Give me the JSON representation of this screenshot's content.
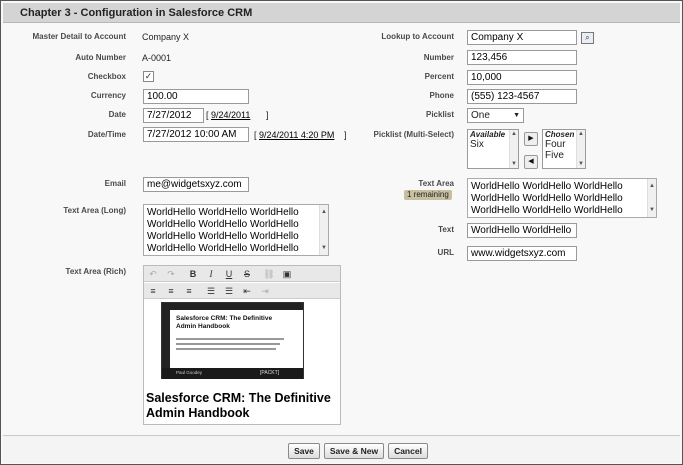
{
  "header": {
    "title": "Chapter 3 - Configuration in Salesforce CRM"
  },
  "left": {
    "master_detail": {
      "label": "Master Detail to Account",
      "value": "Company X"
    },
    "auto_number": {
      "label": "Auto Number",
      "value": "A-0001"
    },
    "checkbox": {
      "label": "Checkbox",
      "checked_mark": "✓"
    },
    "currency": {
      "label": "Currency",
      "value": "100.00"
    },
    "date": {
      "label": "Date",
      "value": "7/27/2012",
      "bracket_open": "[",
      "link": "9/24/2011",
      "bracket_close": "]"
    },
    "datetime": {
      "label": "Date/Time",
      "value": "7/27/2012 10:00 AM",
      "bracket_open": "[",
      "link": "9/24/2011 4:20 PM",
      "bracket_close": "]"
    },
    "email": {
      "label": "Email",
      "value": "me@widgetsxyz.com"
    },
    "text_area_long": {
      "label": "Text Area (Long)",
      "lines": [
        "WorldHello WorldHello WorldHello",
        "WorldHello WorldHello WorldHello",
        "WorldHello WorldHello WorldHello",
        "WorldHello WorldHello WorldHello"
      ]
    },
    "text_area_rich": {
      "label": "Text Area (Rich)",
      "toolbar_row1": [
        "↶",
        "↷",
        "B",
        "I",
        "U",
        "S",
        "⛓",
        "▣"
      ],
      "toolbar_row2": [
        "≡",
        "≡",
        "≡",
        "☰",
        "☰",
        "⇤",
        "⇥"
      ],
      "book": {
        "title_line1": "Salesforce CRM: The Definitive",
        "title_line2": "Admin Handbook",
        "author": "Paul Goodey",
        "publisher": "[PACKT]"
      },
      "heading_line1": "Salesforce CRM: The Definitive",
      "heading_line2": "Admin Handbook"
    }
  },
  "right": {
    "lookup": {
      "label": "Lookup to Account",
      "value": "Company X"
    },
    "number": {
      "label": "Number",
      "value": "123,456"
    },
    "percent": {
      "label": "Percent",
      "value": "10,000"
    },
    "phone": {
      "label": "Phone",
      "value": "(555) 123-4567"
    },
    "picklist": {
      "label": "Picklist",
      "value": "One"
    },
    "multiselect": {
      "label": "Picklist (Multi-Select)",
      "available_header": "Available",
      "available": [
        "Six"
      ],
      "chosen_header": "Chosen",
      "chosen": [
        "Four",
        "Five"
      ],
      "add_arrow": "▶",
      "remove_arrow": "◀"
    },
    "text_area": {
      "label": "Text Area",
      "remaining": "1 remaining",
      "lines": [
        "WorldHello WorldHello WorldHello",
        "WorldHello WorldHello WorldHello",
        "WorldHello WorldHello WorldHello"
      ]
    },
    "text": {
      "label": "Text",
      "value": "WorldHello WorldHello"
    },
    "url": {
      "label": "URL",
      "value": "www.widgetsxyz.com"
    }
  },
  "footer": {
    "save": "Save",
    "save_new": "Save & New",
    "cancel": "Cancel"
  }
}
